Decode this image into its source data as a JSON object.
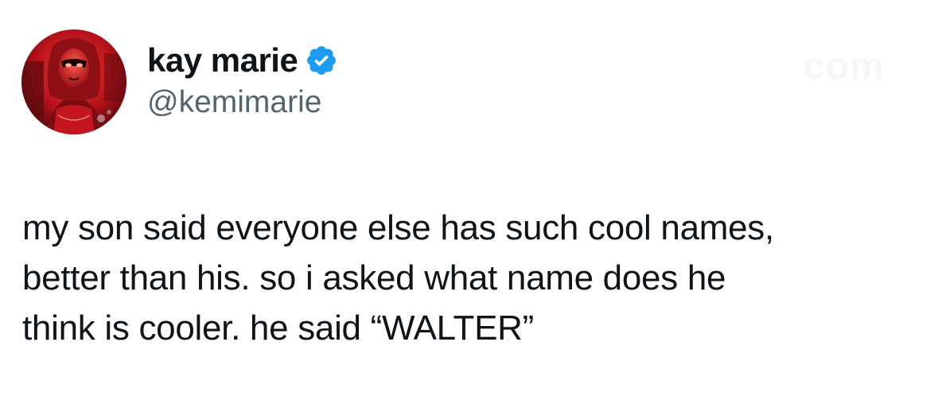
{
  "author": {
    "display_name": "kay marie",
    "handle": "@kemimarie",
    "verified": true,
    "verified_icon": "verified-badge-icon",
    "verified_color": "#1d9bf0",
    "avatar_icon": "profile-photo"
  },
  "tweet": {
    "lines": [
      "my son said everyone else has such cool names,",
      "better than his. so i asked what name does he",
      "think is cooler. he said “WALTER”"
    ]
  },
  "colors": {
    "text": "#0f1419",
    "handle": "#536471",
    "background": "#ffffff"
  }
}
